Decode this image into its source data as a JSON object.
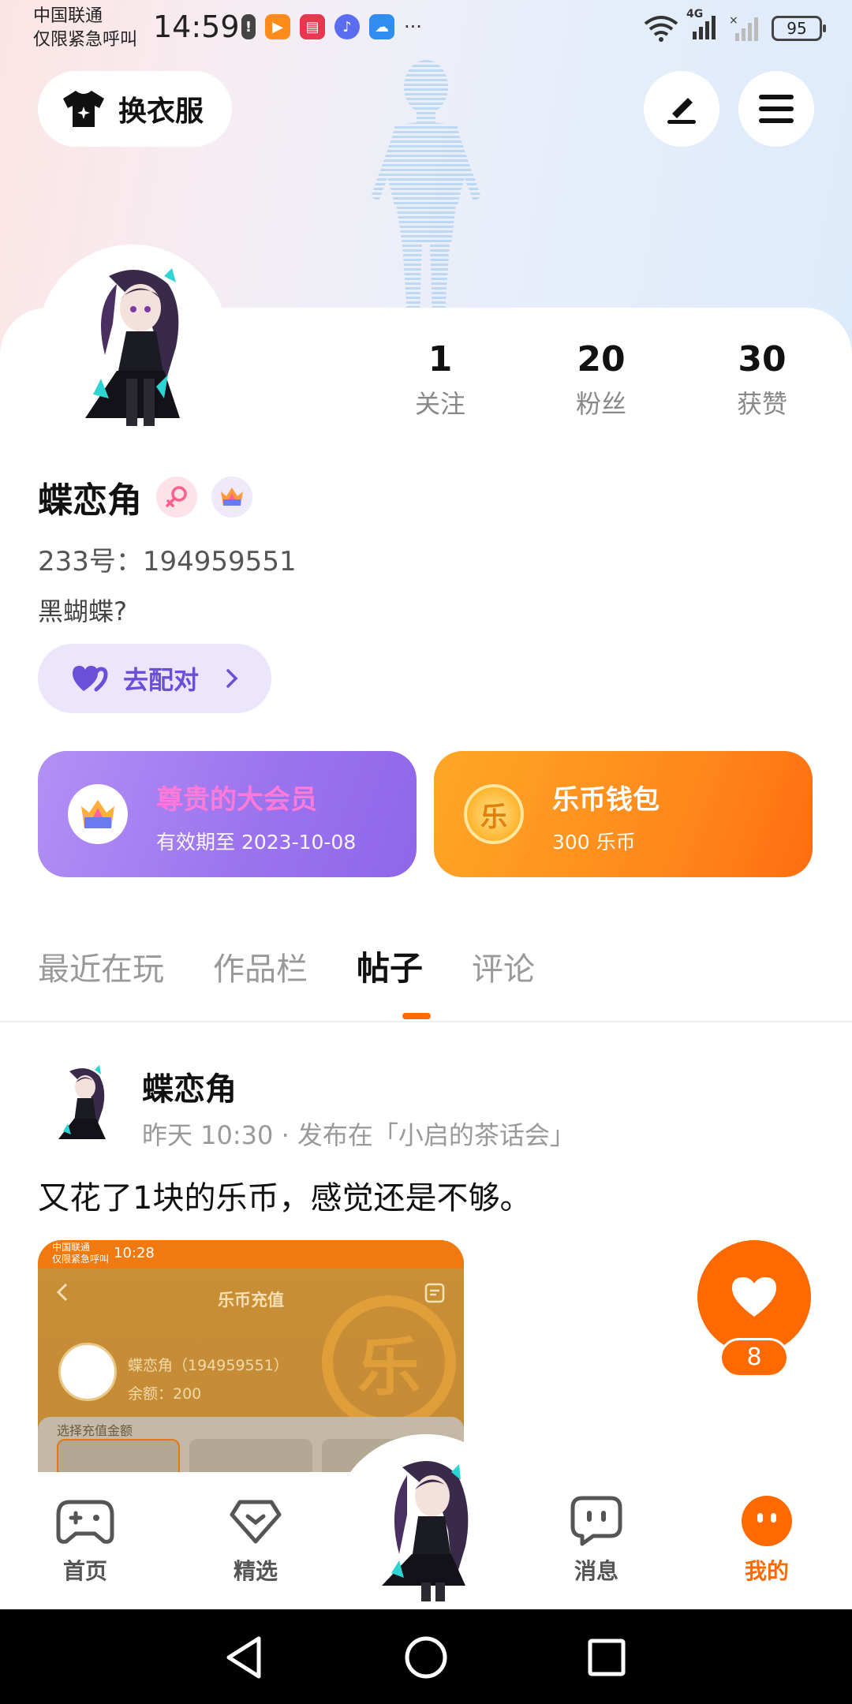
{
  "status_bar": {
    "carrier_line1": "中国联通",
    "carrier_line2": "仅限紧急呼叫",
    "time": "14:59",
    "more": "···",
    "network": "4G",
    "battery": "95"
  },
  "header": {
    "outfit_label": "换衣服"
  },
  "profile": {
    "stats": [
      {
        "value": "1",
        "label": "关注"
      },
      {
        "value": "20",
        "label": "粉丝"
      },
      {
        "value": "30",
        "label": "获赞"
      }
    ],
    "username": "蝶恋角",
    "uid": "233号：194959551",
    "bio": "黑蝴蝶?",
    "pair_label": "去配对",
    "vip": {
      "title": "尊贵的大会员",
      "subtitle": "有效期至 2023-10-08"
    },
    "wallet": {
      "title": "乐币钱包",
      "subtitle": "300 乐币",
      "coin_char": "乐"
    }
  },
  "tabs": [
    {
      "label": "最近在玩"
    },
    {
      "label": "作品栏"
    },
    {
      "label": "帖子"
    },
    {
      "label": "评论"
    }
  ],
  "post": {
    "author": "蝶恋角",
    "meta": "昨天 10:30 · 发布在「小启的茶话会」",
    "text": "又花了1块的乐币，感觉还是不够。",
    "image": {
      "carrier_line1": "中国联通",
      "carrier_line2": "仅限紧急呼叫",
      "time": "10:28",
      "title": "乐币充值",
      "name": "蝶恋角（194959551）",
      "balance": "余额：200",
      "section": "选择充值金额",
      "coin_char": "乐"
    },
    "like_count": "8"
  },
  "bottom_nav": [
    {
      "label": "首页"
    },
    {
      "label": "精选"
    },
    {
      "label": "消息"
    },
    {
      "label": "我的"
    }
  ],
  "colors": {
    "accent": "#ff6a00",
    "vip_purple": "#9b72ee",
    "pair_purple": "#6a4fd8",
    "vip_title": "#ff7ad9"
  }
}
